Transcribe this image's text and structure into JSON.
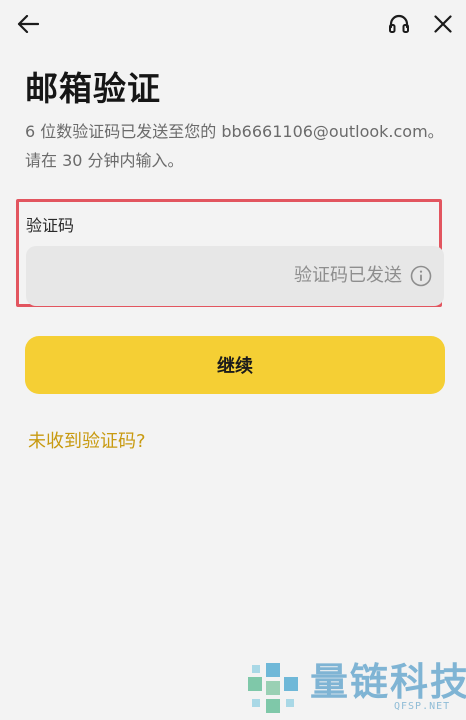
{
  "header": {
    "back_icon": "arrow-left-icon",
    "support_icon": "headset-icon",
    "close_icon": "close-icon"
  },
  "page": {
    "title": "邮箱验证",
    "description_line1": "6 位数验证码已发送至您的 bb6661106@outlook.com。",
    "description_line2": "请在 30 分钟内输入。"
  },
  "code_field": {
    "label": "验证码",
    "value": "",
    "status_text": "验证码已发送",
    "status_icon": "info-icon"
  },
  "actions": {
    "continue_label": "继续",
    "not_received_label": "未收到验证码?"
  },
  "watermark": {
    "text": "量链科技",
    "sub": "QFSP.NET"
  },
  "colors": {
    "accent": "#f5cf34",
    "link": "#c89a10",
    "highlight_border": "#e2555f",
    "background": "#f3f3f3"
  }
}
